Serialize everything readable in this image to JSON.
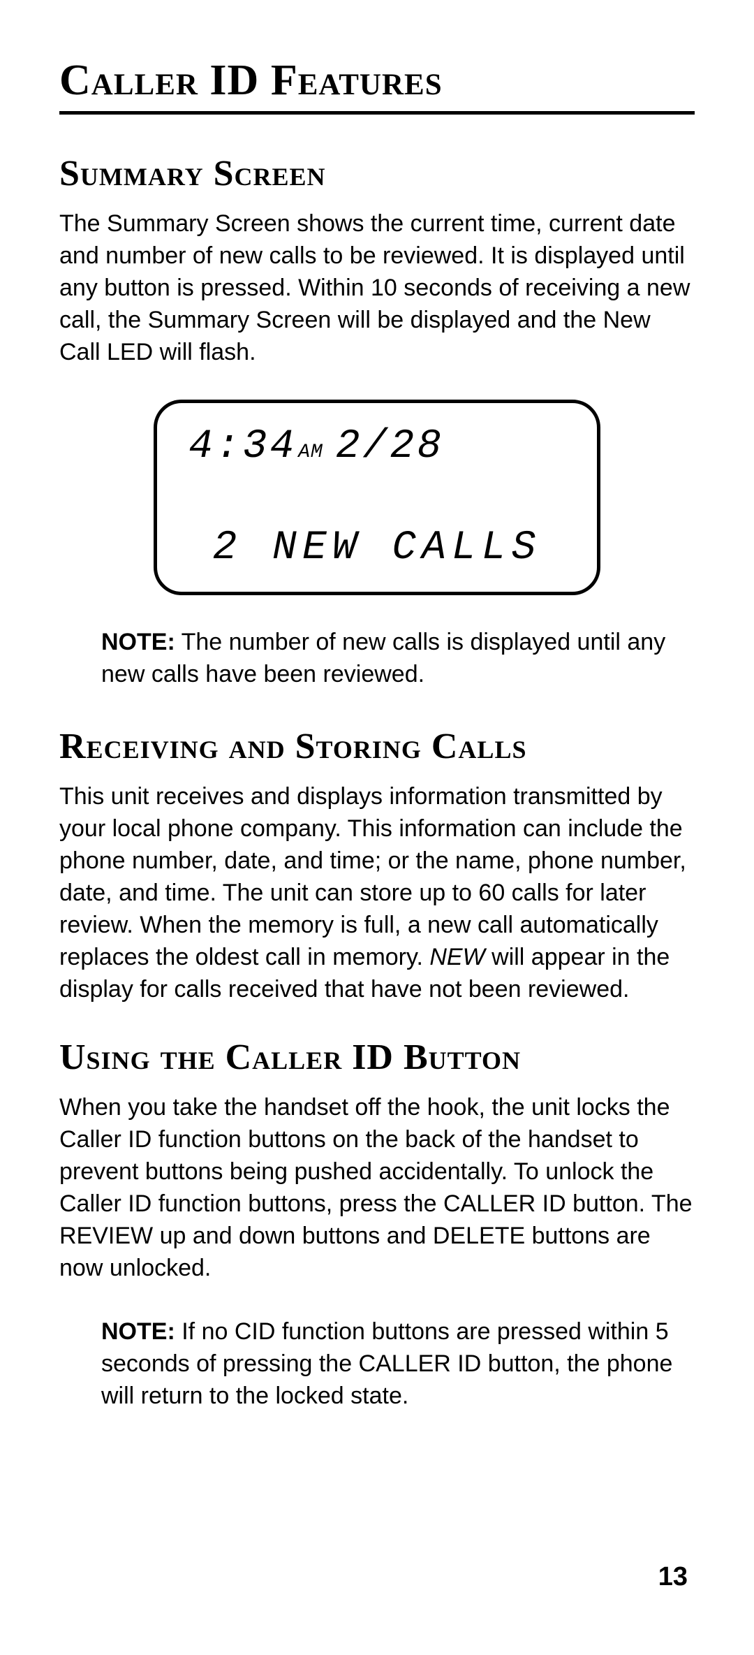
{
  "mainHeading": "Caller ID Features",
  "sections": {
    "summary": {
      "heading": "Summary Screen",
      "body": "The Summary Screen shows the current time, current date and number of new calls to be reviewed. It is displayed until any button is pressed. Within 10 seconds of receiving a new call, the Summary Screen will be displayed and the New Call LED will flash.",
      "lcd": {
        "time": "4:34",
        "ampm": "AM",
        "date": "2/28",
        "line2": "2 NEW CALLS"
      },
      "noteLabel": "NOTE:",
      "noteText": " The number of new calls is displayed until any new calls have been reviewed."
    },
    "receiving": {
      "heading": "Receiving and Storing Calls",
      "bodyPart1": "This unit receives and displays information transmitted by your local phone company. This information can include the phone number, date, and time; or the name, phone number, date, and time. The unit can store up to 60 calls for later review. When the memory is full, a new call automatically replaces the oldest call in memory. ",
      "bodyItalic": "NEW",
      "bodyPart2": " will appear in the display for calls received that have not been reviewed."
    },
    "usingButton": {
      "heading": "Using the Caller ID Button",
      "body": "When you take the handset off the hook, the unit locks the Caller ID function buttons on the back of the handset to prevent buttons being pushed accidentally. To unlock the Caller ID function buttons, press the CALLER ID button. The REVIEW up and down buttons and DELETE buttons are now unlocked.",
      "noteLabel": "NOTE:",
      "noteText": " If no CID function buttons are pressed within 5 seconds of pressing the CALLER ID button, the phone will return to the locked state."
    }
  },
  "pageNumber": "13"
}
